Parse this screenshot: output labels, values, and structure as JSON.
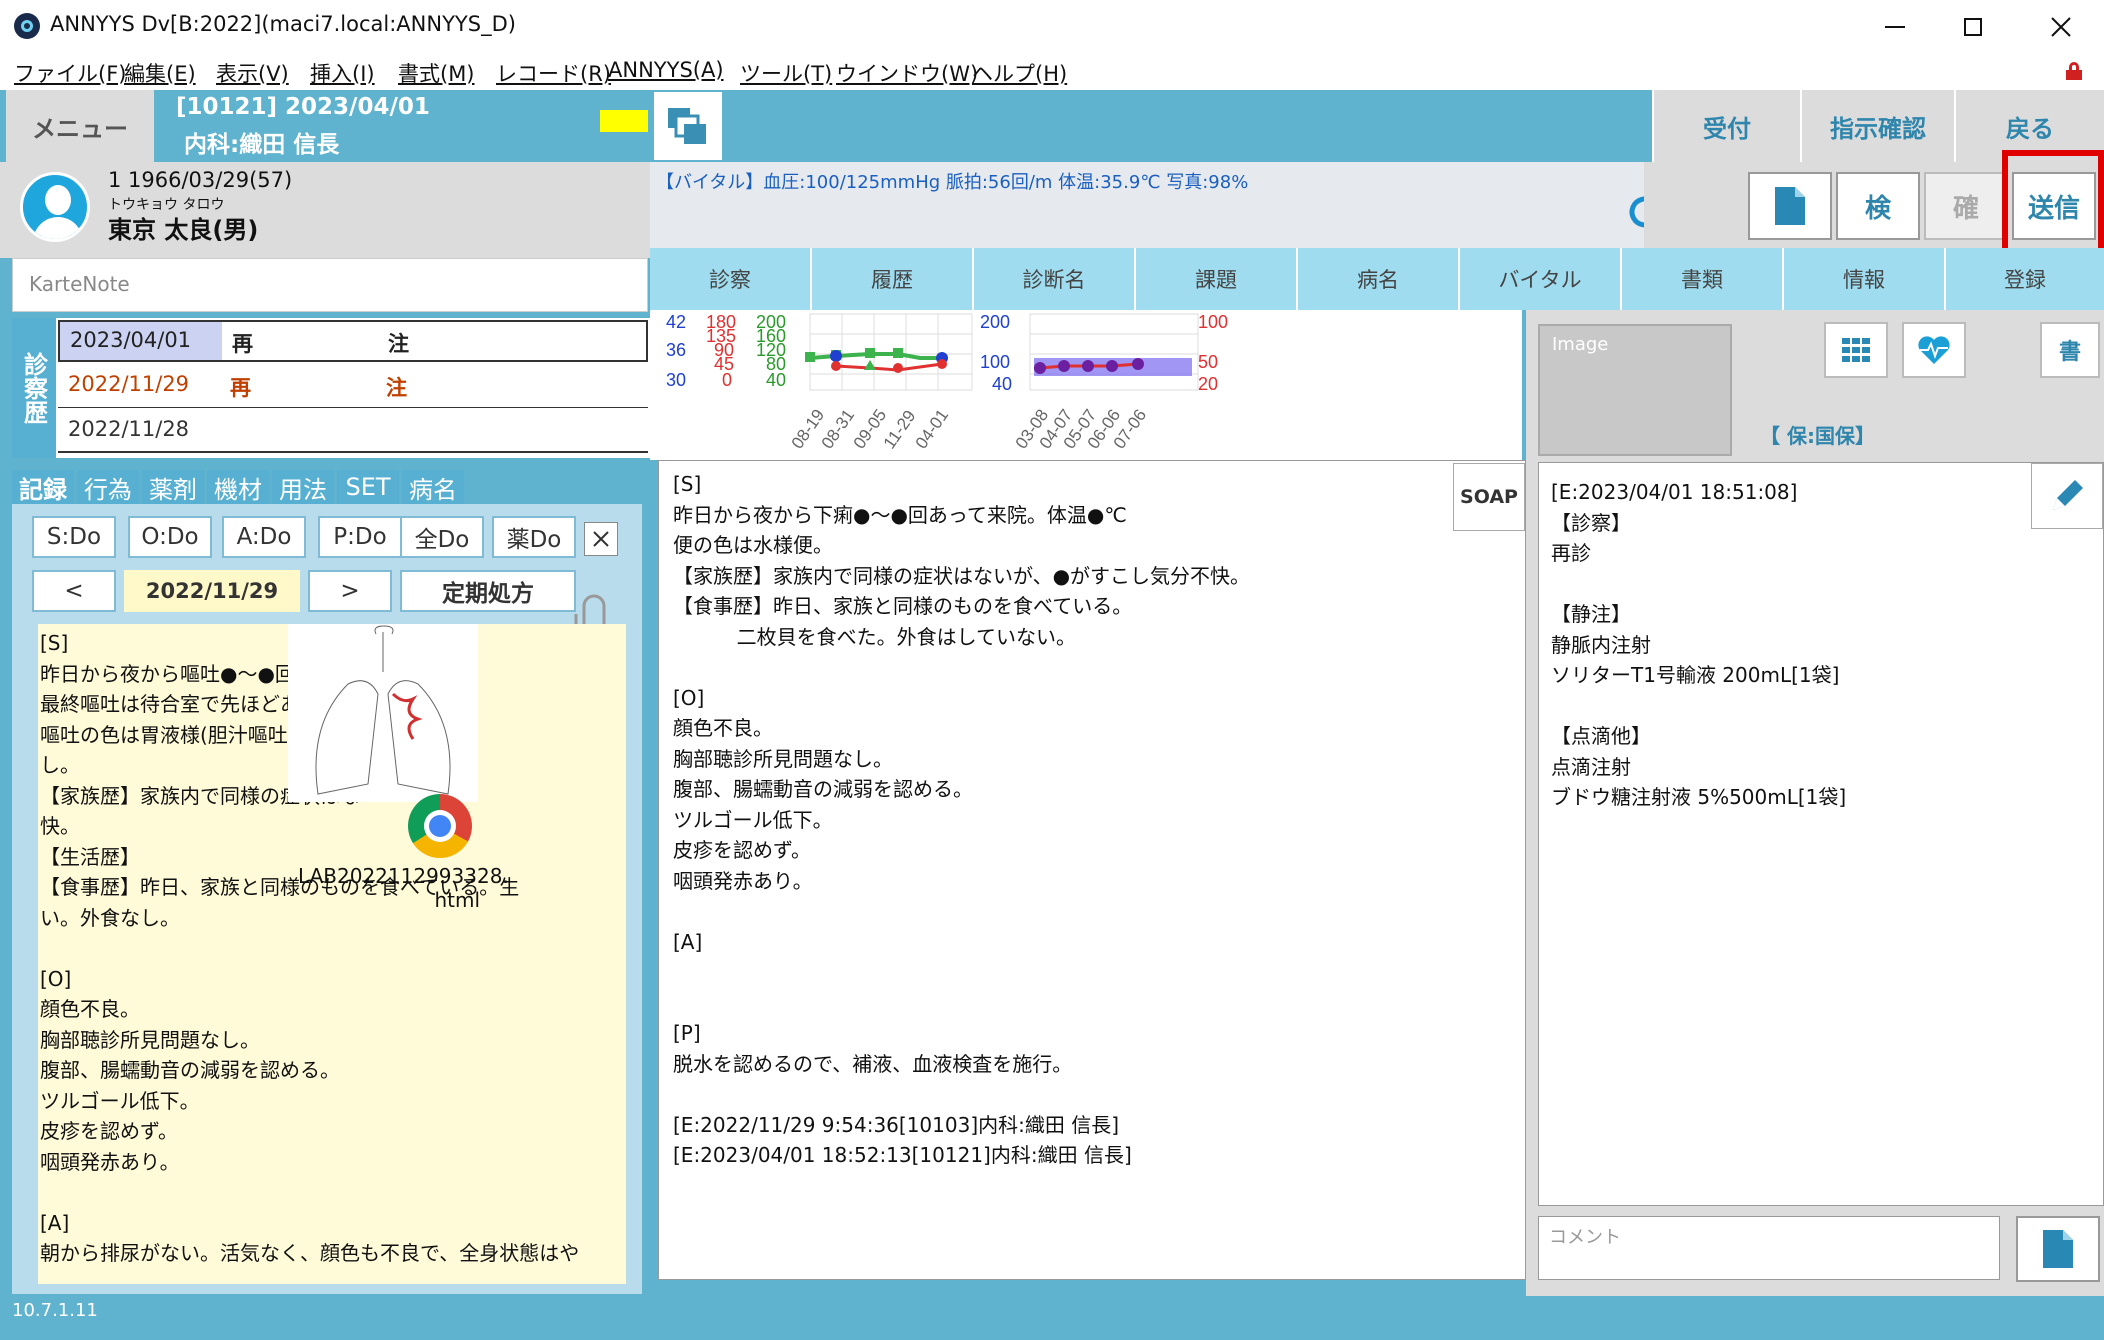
{
  "window": {
    "title": "ANNYYS Dv[B:2022](maci7.local:ANNYYS_D)"
  },
  "menubar": [
    "ファイル(F)",
    "編集(E)",
    "表示(V)",
    "挿入(I)",
    "書式(M)",
    "レコード(R)",
    "ANNYYS(A)",
    "ツール(T)",
    "ウインドウ(W)",
    "ヘルプ(H)"
  ],
  "header": {
    "menu_label": "メニュー",
    "visit_line": "[10121] 2023/04/01",
    "dept_line": "内科:織田 信長",
    "btn_reception": "受付",
    "btn_instruction": "指示確認",
    "btn_back": "戻る"
  },
  "patient": {
    "id_line": "1 1966/03/29(57)",
    "kana": "トウキョウ タロウ",
    "name": "東京 太良(男)"
  },
  "vitals": {
    "text": "【バイタル】血圧:100/125mmHg 脈拍:56回/m 体温:35.9℃ 写真:98%"
  },
  "actions": {
    "exam": "検",
    "confirm": "確",
    "send": "送信"
  },
  "tabs": [
    "診察",
    "履歴",
    "診断名",
    "課題",
    "病名",
    "バイタル",
    "書類",
    "情報",
    "登録"
  ],
  "karte_note": {
    "placeholder": "KarteNote"
  },
  "history": {
    "side_label": "診察歴",
    "rows": [
      {
        "date": "2023/04/01",
        "type": "再",
        "note": "注"
      },
      {
        "date": "2022/11/29",
        "type": "再",
        "note": "注"
      },
      {
        "date": "2022/11/28",
        "type": "",
        "note": ""
      }
    ]
  },
  "left_tabs": [
    "記録",
    "行為",
    "薬剤",
    "機材",
    "用法",
    "SET",
    "病名"
  ],
  "do_buttons": [
    "S:Do",
    "O:Do",
    "A:Do",
    "P:Do",
    "全Do",
    "薬Do"
  ],
  "nav": {
    "prev": "<",
    "date": "2022/11/29",
    "next": ">",
    "periodic": "定期処方"
  },
  "left_record": {
    "text": "[S]\n昨日から夜から嘔吐●～●回あっ\n最終嘔吐は待合室で先ほどあった\n嘔吐の色は胃液様(胆汁嘔吐では\nし。\n【家族歴】家族内で同様の症状はな\n快。\n【生活歴】\n【食事歴】昨日、家族と同様のものを食べている。生\nい。外食なし。\n\n[O]\n顔色不良。\n胸部聴診所見問題なし。\n腹部、腸蠕動音の減弱を認める。\nツルゴール低下。\n皮疹を認めず。\n咽頭発赤あり。\n\n[A]\n朝から排尿がない。活気なく、顔色も不良で、全身状態はや",
    "attachment_file": "LAB2022112993328.\nhtml"
  },
  "charts": {
    "left": {
      "y_blue": [
        "42",
        "36",
        "30"
      ],
      "y_red": [
        "180",
        "135",
        "90",
        "45",
        "0"
      ],
      "y_green": [
        "200",
        "160",
        "120",
        "80",
        "40"
      ],
      "x": [
        "08-19",
        "08-31",
        "09-05",
        "11-29",
        "04-01"
      ]
    },
    "right": {
      "y_blue": [
        "200",
        "100",
        "40"
      ],
      "y_red": [
        "100",
        "50",
        "20"
      ],
      "x": [
        "03-08",
        "04-07",
        "05-07",
        "06-06",
        "07-06"
      ]
    }
  },
  "chart_data": [
    {
      "type": "line",
      "categories": [
        "08-19",
        "08-31",
        "09-05",
        "11-29",
        "04-01"
      ],
      "series": [],
      "ylim": [
        0,
        200
      ]
    },
    {
      "type": "line",
      "categories": [
        "03-08",
        "04-07",
        "05-07",
        "06-06",
        "07-06"
      ],
      "series": [],
      "ylim": [
        20,
        200
      ]
    }
  ],
  "soap": {
    "button": "SOAP",
    "text": "[S]\n昨日から夜から下痢●～●回あって来院。体温●℃\n便の色は水様便。\n【家族歴】家族内で同様の症状はないが、●がすこし気分不快。\n【食事歴】昨日、家族と同様のものを食べている。\n          二枚貝を食べた。外食はしていない。\n\n[O]\n顔色不良。\n胸部聴診所見問題なし。\n腹部、腸蠕動音の減弱を認める。\nツルゴール低下。\n皮疹を認めず。\n咽頭発赤あり。\n\n[A]\n\n\n[P]\n脱水を認めるので、補液、血液検査を施行。\n\n[E:2022/11/29 9:54:36[10103]内科:織田 信長]\n[E:2023/04/01 18:52:13[10121]内科:織田 信長]"
  },
  "right_panel": {
    "image_label": "Image",
    "doc_btn": "書",
    "insurance": "【 保:国保】",
    "order_text": "[E:2023/04/01 18:51:08]\n【診察】\n再診\n\n【静注】\n静脈内注射\nソリターT1号輸液 200mL[1袋]\n\n【点滴他】\n点滴注射\nブドウ糖注射液 5%500mL[1袋]",
    "comment_placeholder": "コメント"
  },
  "status": {
    "version": "10.7.1.11"
  },
  "colors": {
    "accent": "#5fb3cf",
    "tab": "#9fdcef",
    "highlight": "#e00000",
    "note_bg": "#fffbd9"
  }
}
